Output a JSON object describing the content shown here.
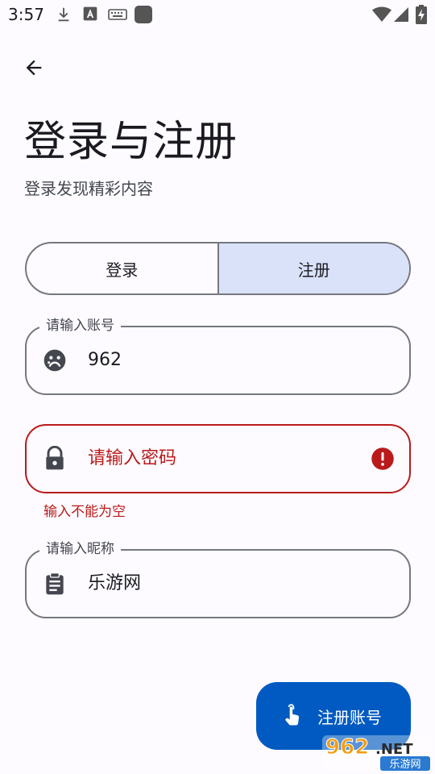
{
  "status_bar": {
    "time": "3:57",
    "left_icons": [
      "download-icon",
      "text-a-icon",
      "keyboard-icon",
      "app-square-icon"
    ],
    "right_icons": [
      "wifi-icon",
      "cellular-signal-icon",
      "battery-charging-icon"
    ]
  },
  "header": {
    "back_icon": "arrow-back-icon",
    "title": "登录与注册",
    "subtitle": "登录发现精彩内容"
  },
  "segmented": {
    "login_label": "登录",
    "register_label": "注册",
    "selected": "注册"
  },
  "fields": {
    "account": {
      "label": "请输入账号",
      "value": "962",
      "icon": "face-sad-icon"
    },
    "password": {
      "placeholder": "请输入密码",
      "icon": "lock-icon",
      "error_icon": "error-circle-icon",
      "error_text": "输入不能为空"
    },
    "nickname": {
      "label": "请输入昵称",
      "value": "乐游网",
      "icon": "clipboard-icon"
    }
  },
  "fab": {
    "label": "注册账号",
    "icon": "touch-hand-icon"
  },
  "watermark": {
    "brand": "962.NET",
    "caption": "乐游网"
  },
  "colors": {
    "primary": "#005ac1",
    "selected_segment": "#dae2f9",
    "error": "#ba1a1a",
    "outline": "#75777f",
    "background": "#fdfbff"
  }
}
